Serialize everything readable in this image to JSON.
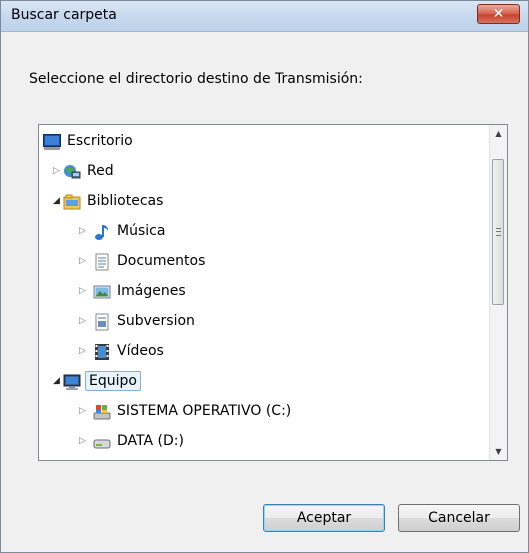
{
  "window": {
    "title": "Buscar carpeta",
    "close_label": "✕"
  },
  "instruction": "Seleccione el directorio destino de Transmisión:",
  "tree": [
    {
      "label": "Escritorio",
      "icon": "desktop-icon",
      "name": "tree-item-escritorio",
      "expander": "none",
      "selected": false
    },
    {
      "label": "Red",
      "icon": "network-icon",
      "name": "tree-item-red",
      "expander": "collapsed",
      "selected": false
    },
    {
      "label": "Bibliotecas",
      "icon": "libraries-icon",
      "name": "tree-item-bibliotecas",
      "expander": "expanded",
      "selected": false
    },
    {
      "label": "Música",
      "icon": "music-icon",
      "name": "tree-item-musica",
      "expander": "collapsed",
      "selected": false
    },
    {
      "label": "Documentos",
      "icon": "documents-icon",
      "name": "tree-item-documentos",
      "expander": "collapsed",
      "selected": false
    },
    {
      "label": "Imágenes",
      "icon": "pictures-icon",
      "name": "tree-item-imagenes",
      "expander": "collapsed",
      "selected": false
    },
    {
      "label": "Subversion",
      "icon": "subversion-icon",
      "name": "tree-item-subversion",
      "expander": "collapsed",
      "selected": false
    },
    {
      "label": "Vídeos",
      "icon": "videos-icon",
      "name": "tree-item-videos",
      "expander": "collapsed",
      "selected": false
    },
    {
      "label": "Equipo",
      "icon": "computer-icon",
      "name": "tree-item-equipo",
      "expander": "expanded",
      "selected": true
    },
    {
      "label": "SISTEMA OPERATIVO (C:)",
      "icon": "system-drive-icon",
      "name": "tree-item-drive-c",
      "expander": "collapsed",
      "selected": false
    },
    {
      "label": "DATA (D:)",
      "icon": "drive-icon",
      "name": "tree-item-drive-d",
      "expander": "collapsed",
      "selected": false
    }
  ],
  "buttons": {
    "accept": "Aceptar",
    "cancel": "Cancelar"
  },
  "colors": {
    "selection_bg": "#e5f3fb",
    "selection_border": "#84acdd",
    "close_red": "#c84430",
    "title_bar": "#c5d8ee"
  }
}
